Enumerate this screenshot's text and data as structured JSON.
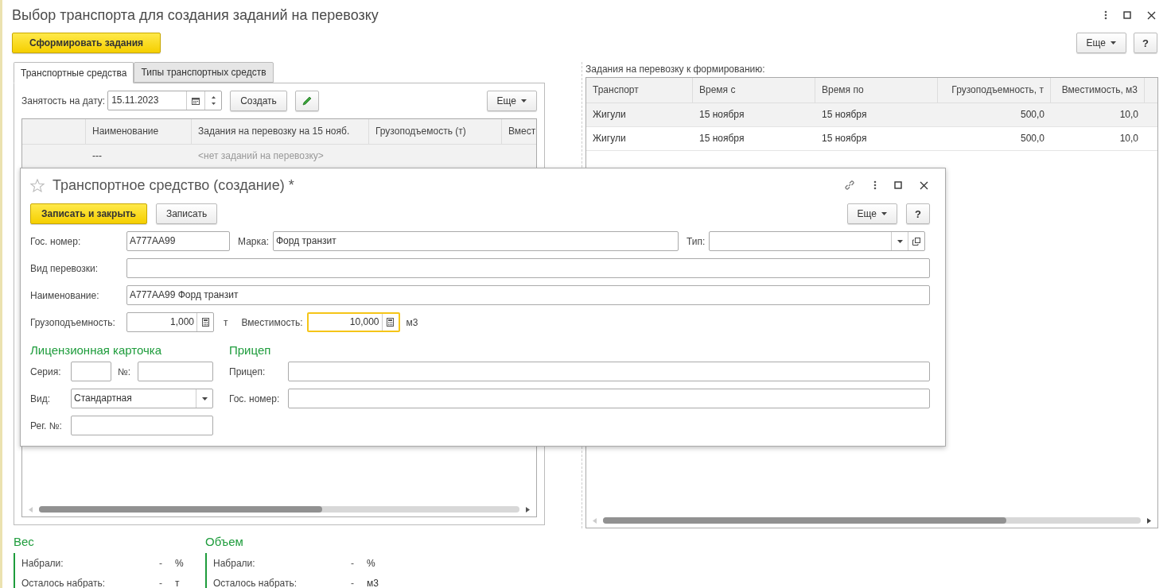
{
  "window": {
    "title": "Выбор транспорта для создания заданий на перевозку"
  },
  "toolbar": {
    "primary_button": "Сформировать задания",
    "more_button": "Еще",
    "help_button": "?"
  },
  "tabs": [
    {
      "label": "Транспортные средства",
      "selected": true
    },
    {
      "label": "Типы транспортных средств",
      "selected": false
    }
  ],
  "vehicles": {
    "date_label": "Занятость на дату:",
    "date_value": "15.11.2023",
    "create_button": "Создать",
    "more_button": "Еще",
    "columns": [
      "Наименование",
      "Задания на перевозку на 15 нояб.",
      "Грузоподъемость (т)",
      "Вмест"
    ],
    "rows": [
      {
        "name": "---",
        "tasks": "<нет заданий на перевозку>"
      }
    ]
  },
  "tasks": {
    "label": "Задания на перевозку к формированию:",
    "columns": [
      "Транспорт",
      "Время с",
      "Время по",
      "Грузоподъемность, т",
      "Вместимость, м3"
    ],
    "rows": [
      [
        "Жигули",
        "15 ноября",
        "15 ноября",
        "500,0",
        "10,0"
      ],
      [
        "Жигули",
        "15 ноября",
        "15 ноября",
        "500,0",
        "10,0"
      ]
    ]
  },
  "dialog": {
    "title": "Транспортное средство (создание) *",
    "save_close_button": "Записать и закрыть",
    "save_button": "Записать",
    "more_button": "Еще",
    "help_button": "?",
    "gov_number": {
      "label": "Гос. номер:",
      "value": "А777АА99"
    },
    "brand": {
      "label": "Марка:",
      "value": "Форд транзит"
    },
    "type": {
      "label": "Тип:"
    },
    "transport_kind": {
      "label": "Вид перевозки:"
    },
    "name": {
      "label": "Наименование:",
      "value": "А777АА99 Форд транзит"
    },
    "capacity": {
      "label": "Грузоподъемность:",
      "value": "1,000",
      "unit": "т",
      "focused": false
    },
    "volume": {
      "label": "Вместимость:",
      "value": "10,000",
      "unit": "м3",
      "focused": true
    },
    "license_card": {
      "title": "Лицензионная карточка",
      "series": {
        "label": "Серия:"
      },
      "number": {
        "label": "№:"
      },
      "kind": {
        "label": "Вид:",
        "value": "Стандартная"
      },
      "reg_number": {
        "label": "Рег. №:"
      }
    },
    "trailer": {
      "title": "Прицеп",
      "trailer": {
        "label": "Прицеп:"
      },
      "gov_number": {
        "label": "Гос. номер:"
      }
    }
  },
  "summary": [
    {
      "title": "Вес",
      "rows": [
        {
          "label": "Набрали:",
          "value": "-",
          "unit": "%"
        },
        {
          "label": "Осталось набрать:",
          "value": "-",
          "unit": "т"
        }
      ]
    },
    {
      "title": "Объем",
      "rows": [
        {
          "label": "Набрали:",
          "value": "-",
          "unit": "%"
        },
        {
          "label": "Осталось набрать:",
          "value": "-",
          "unit": "м3"
        }
      ]
    }
  ]
}
